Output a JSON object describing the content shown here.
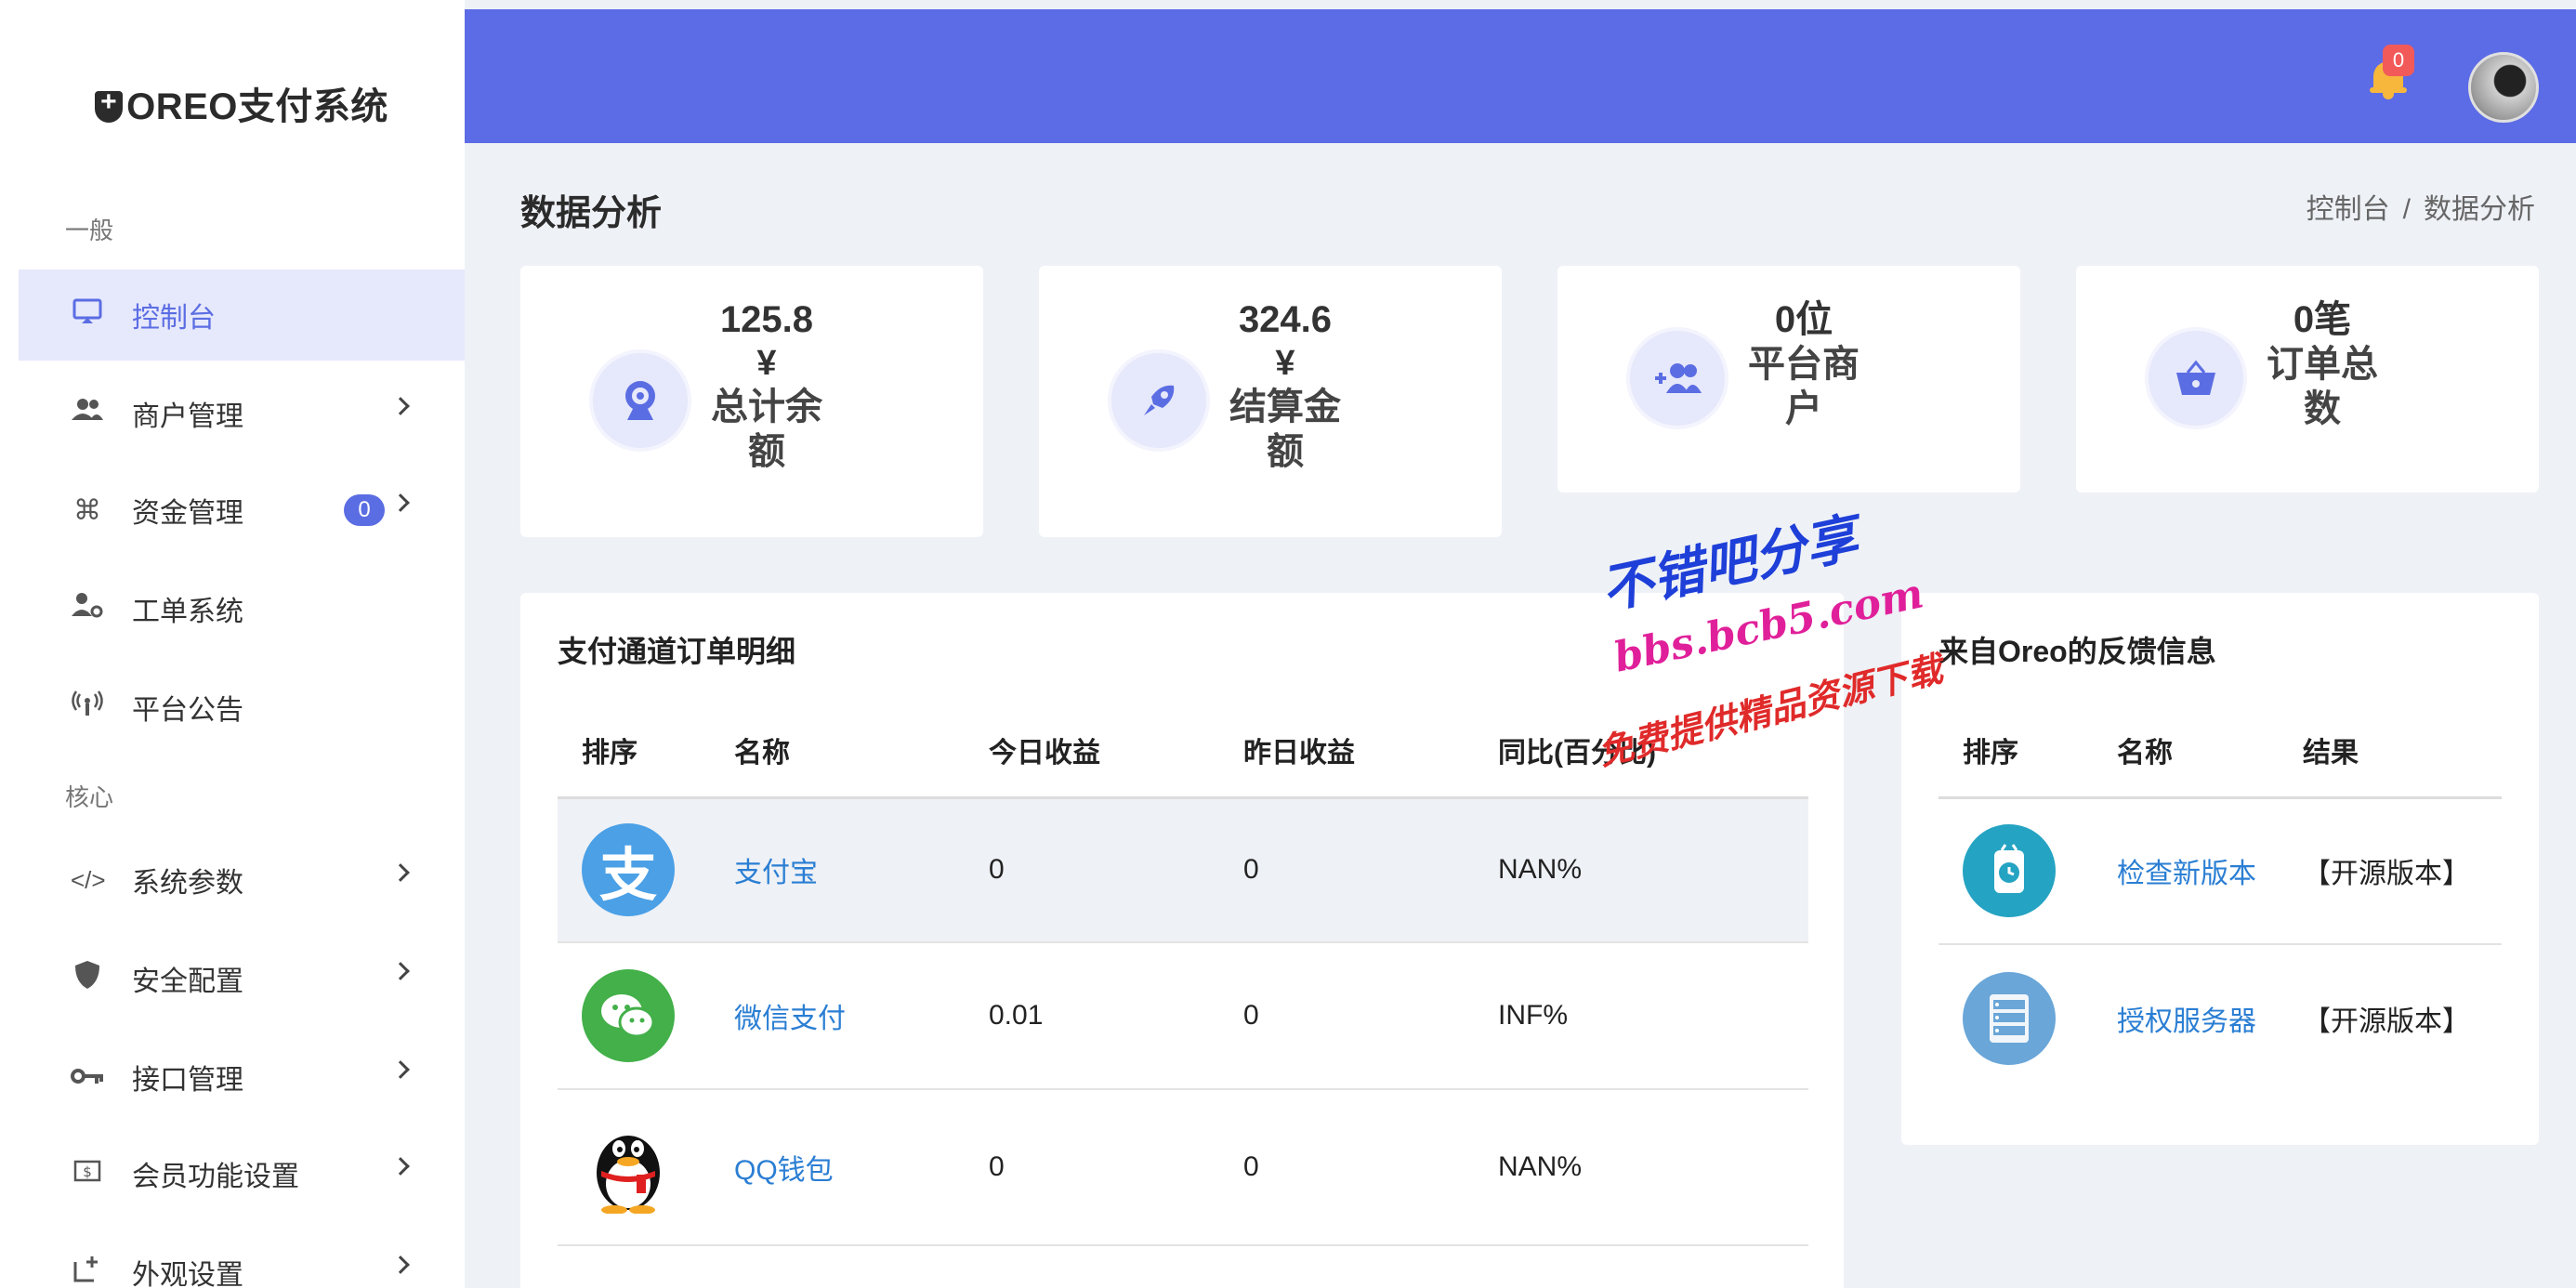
{
  "brand": {
    "name": "OREO支付系统"
  },
  "sidebar": {
    "sections": [
      "一般",
      "核心"
    ],
    "items": [
      {
        "label": "控制台",
        "icon": "monitor-icon"
      },
      {
        "label": "商户管理",
        "icon": "users-icon"
      },
      {
        "label": "资金管理",
        "icon": "command-icon",
        "badge": "0"
      },
      {
        "label": "工单系统",
        "icon": "user-gear-icon"
      },
      {
        "label": "平台公告",
        "icon": "broadcast-icon"
      },
      {
        "label": "系统参数",
        "icon": "code-icon"
      },
      {
        "label": "安全配置",
        "icon": "shield-icon"
      },
      {
        "label": "接口管理",
        "icon": "key-icon"
      },
      {
        "label": "会员功能设置",
        "icon": "dollar-icon"
      },
      {
        "label": "外观设置",
        "icon": "layout-icon"
      }
    ]
  },
  "header": {
    "notification_count": "0"
  },
  "page": {
    "title": "数据分析",
    "breadcrumb": [
      "控制台",
      "/",
      "数据分析"
    ]
  },
  "stats": [
    {
      "value": "125.8",
      "unit": "¥",
      "label": "总计余额",
      "icon": "webcam-icon"
    },
    {
      "value": "324.6",
      "unit": "¥",
      "label": "结算金额",
      "icon": "rocket-icon"
    },
    {
      "value": "0位",
      "unit": "",
      "label": "平台商户",
      "icon": "add-users-icon"
    },
    {
      "value": "0笔",
      "unit": "",
      "label": "订单总数",
      "icon": "basket-icon"
    }
  ],
  "channels": {
    "title": "支付通道订单明细",
    "columns": [
      "排序",
      "名称",
      "今日收益",
      "昨日收益",
      "同比(百分比)"
    ],
    "rows": [
      {
        "logo": "alipay-logo",
        "name": "支付宝",
        "today": "0",
        "yesterday": "0",
        "ratio": "NAN%"
      },
      {
        "logo": "wechat-logo",
        "name": "微信支付",
        "today": "0.01",
        "yesterday": "0",
        "ratio": "INF%"
      },
      {
        "logo": "qq-logo",
        "name": "QQ钱包",
        "today": "0",
        "yesterday": "0",
        "ratio": "NAN%"
      }
    ]
  },
  "feedback": {
    "title": "来自Oreo的反馈信息",
    "columns": [
      "排序",
      "名称",
      "结果"
    ],
    "rows": [
      {
        "icon": "clock-icon",
        "name": "检查新版本",
        "result": "【开源版本】"
      },
      {
        "icon": "server-icon",
        "name": "授权服务器",
        "result": "【开源版本】"
      }
    ]
  },
  "watermark": {
    "line1": "不错吧分享",
    "line2": "bbs.bcb5.com",
    "line3": "免费提供精品资源下载"
  },
  "colors": {
    "accent": "#5c6be6",
    "link": "#2a7ed3",
    "badge": "#f25a5a"
  }
}
